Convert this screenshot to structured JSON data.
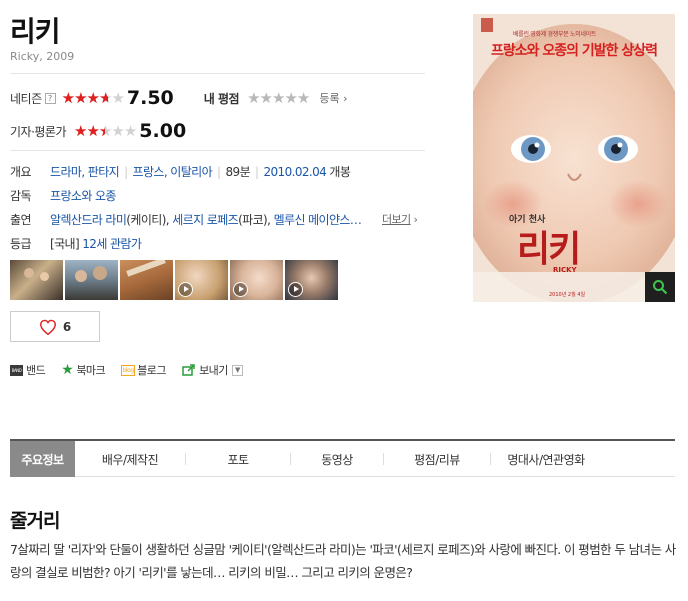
{
  "movie": {
    "title": "리키",
    "subtitle": "Ricky, 2009"
  },
  "ratings": {
    "netizen_label": "네티즌",
    "help_icon_text": "?",
    "netizen_score": "7.50",
    "netizen_stars_value": 3.75,
    "my_rating_label": "내 평점",
    "my_rating_stars_value": 0,
    "register_link": "등록",
    "critic_label": "기자·평론가",
    "critic_score": "5.00",
    "critic_stars_value": 2.5,
    "colors": {
      "star_on": "#e02020",
      "star_off": "#d2d2d2"
    }
  },
  "info": {
    "genre_label": "개요",
    "genres": "드라마, 판타지",
    "countries": "프랑스, 이탈리아",
    "runtime": "89분",
    "release_date": "2010.02.04",
    "release_suffix": "개봉",
    "director_label": "감독",
    "director": "프랑소와 오종",
    "cast_label": "출연",
    "cast": [
      {
        "name": "알렉산드라 라미",
        "role": "(케이티)"
      },
      {
        "name": "세르지 로페즈",
        "role": "(파코)"
      },
      {
        "name": "멜루신 메이얀스…",
        "role": ""
      }
    ],
    "cast_more": "더보기",
    "grade_label": "등급",
    "grade_region": "[국내]",
    "grade": "12세 관람가"
  },
  "thumbnails": [
    {
      "type": "photo",
      "icon": "photo"
    },
    {
      "type": "photo",
      "icon": "photo"
    },
    {
      "type": "photo",
      "icon": "photo"
    },
    {
      "type": "video",
      "icon": "play-icon"
    },
    {
      "type": "video",
      "icon": "play-icon"
    },
    {
      "type": "video",
      "icon": "play-icon"
    }
  ],
  "like": {
    "count": "6"
  },
  "share": {
    "band": "밴드",
    "band_icon_text": "BAND",
    "bookmark": "북마크",
    "blog": "블로그",
    "blog_icon_text": "blog",
    "send": "보내기"
  },
  "poster": {
    "festival_text": "베를린 영화제 경쟁부문 노미네이트",
    "tagline": "프랑소와 오종의 기발한 상상력",
    "small_title": "아기 천사",
    "big_title": "리키",
    "english_title": "RICKY",
    "release_text": "2010년 2월 4일"
  },
  "tabs": [
    {
      "label": "주요정보",
      "active": true
    },
    {
      "label": "배우/제작진",
      "active": false
    },
    {
      "label": "포토",
      "active": false
    },
    {
      "label": "동영상",
      "active": false
    },
    {
      "label": "평점/리뷰",
      "active": false
    },
    {
      "label": "명대사/연관영화",
      "active": false
    }
  ],
  "synopsis": {
    "heading": "줄거리",
    "text": "7살짜리 딸 '리자'와 단둘이 생활하던 싱글맘 '케이티'(알렉산드라 라미)는 '파코'(세르지 로페즈)와 사랑에 빠진다. 이 평범한 두 남녀는 사랑의 결실로 비범한? 아기 '리키'를 낳는데… 리키의 비밀… 그리고 리키의 운명은?"
  }
}
